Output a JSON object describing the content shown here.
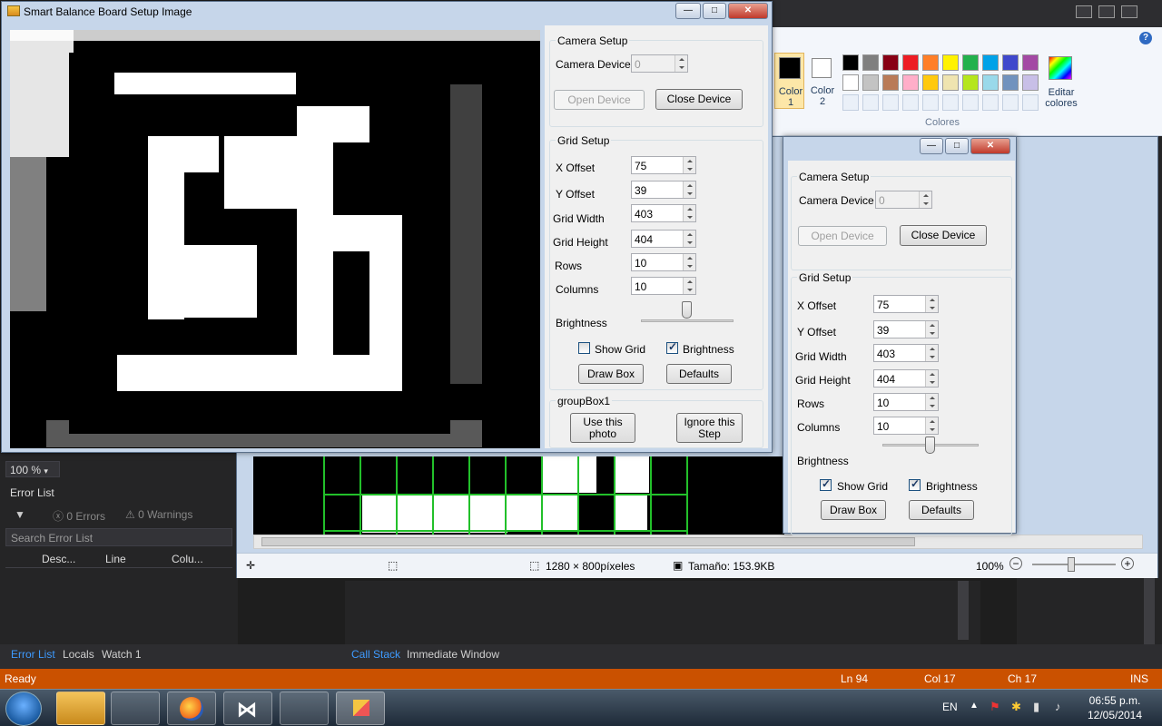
{
  "setup_window": {
    "title": "Smart Balance Board Setup Image",
    "camera_group": {
      "title": "Camera Setup",
      "device_label": "Camera Device",
      "device_value": "0",
      "open_label": "Open Device",
      "close_label": "Close Device"
    },
    "grid_group": {
      "title": "Grid Setup",
      "fields": [
        {
          "label": "X Offset",
          "value": "75"
        },
        {
          "label": "Y Offset",
          "value": "39"
        },
        {
          "label": "Grid Width",
          "value": "403"
        },
        {
          "label": "Grid Height",
          "value": "404"
        },
        {
          "label": "Rows",
          "value": "10"
        },
        {
          "label": "Columns",
          "value": "10"
        }
      ],
      "brightness_label": "Brightness",
      "brightness_level": 0.5,
      "show_grid_label": "Show Grid",
      "show_grid_checked": false,
      "brightness_check_label": "Brightness",
      "brightness_checked": true,
      "draw_box_label": "Draw Box",
      "defaults_label": "Defaults"
    },
    "group1": {
      "title": "groupBox1",
      "use_photo_label": "Use this photo",
      "ignore_label": "Ignore this Step"
    }
  },
  "second_window": {
    "camera_group": {
      "title": "Camera Setup",
      "device_label": "Camera Device",
      "device_value": "0",
      "open_label": "Open Device",
      "close_label": "Close Device"
    },
    "grid_group": {
      "title": "Grid Setup",
      "fields": [
        {
          "label": "X Offset",
          "value": "75"
        },
        {
          "label": "Y Offset",
          "value": "39"
        },
        {
          "label": "Grid Width",
          "value": "403"
        },
        {
          "label": "Grid Height",
          "value": "404"
        },
        {
          "label": "Rows",
          "value": "10"
        },
        {
          "label": "Columns",
          "value": "10"
        }
      ],
      "brightness_label": "Brightness",
      "show_grid_label": "Show Grid",
      "show_grid_checked": true,
      "brightness_check_label": "Brightness",
      "brightness_checked": true,
      "draw_box_label": "Draw Box",
      "defaults_label": "Defaults"
    }
  },
  "paint": {
    "color1_label": "Color 1",
    "color2_label": "Color 2",
    "colors_label": "Colores",
    "edit_colors_label": "Editar colores",
    "palette_row1": [
      "#000000",
      "#7f7f7f",
      "#880015",
      "#ed1c24",
      "#ff7f27",
      "#fff200",
      "#22b14c",
      "#00a2e8",
      "#3f48cc",
      "#a349a4"
    ],
    "palette_row2": [
      "#ffffff",
      "#c3c3c3",
      "#b97a57",
      "#ffaec9",
      "#ffc90e",
      "#efe4b0",
      "#b5e61d",
      "#99d9ea",
      "#7092be",
      "#c8bfe7"
    ],
    "status_size": "1280 × 800píxeles",
    "status_file": "Tamaño: 153.9KB",
    "zoom": "100%"
  },
  "vs": {
    "zoom": "100 %",
    "error_list_title": "Error List",
    "errors": "0 Errors",
    "warnings": "0 Warnings",
    "search": "Search Error List",
    "col_desc": "Desc...",
    "col_line": "Line",
    "col_col": "Colu...",
    "tabs_left": [
      "Error List",
      "Locals",
      "Watch 1"
    ],
    "tabs_mid": [
      "Call Stack",
      "Immediate Window"
    ],
    "status": {
      "ready": "Ready",
      "ln": "Ln 94",
      "col": "Col 17",
      "ch": "Ch 17",
      "ins": "INS"
    }
  },
  "taskbar": {
    "lang": "EN",
    "time": "06:55 p.m.",
    "date": "12/05/2014"
  }
}
